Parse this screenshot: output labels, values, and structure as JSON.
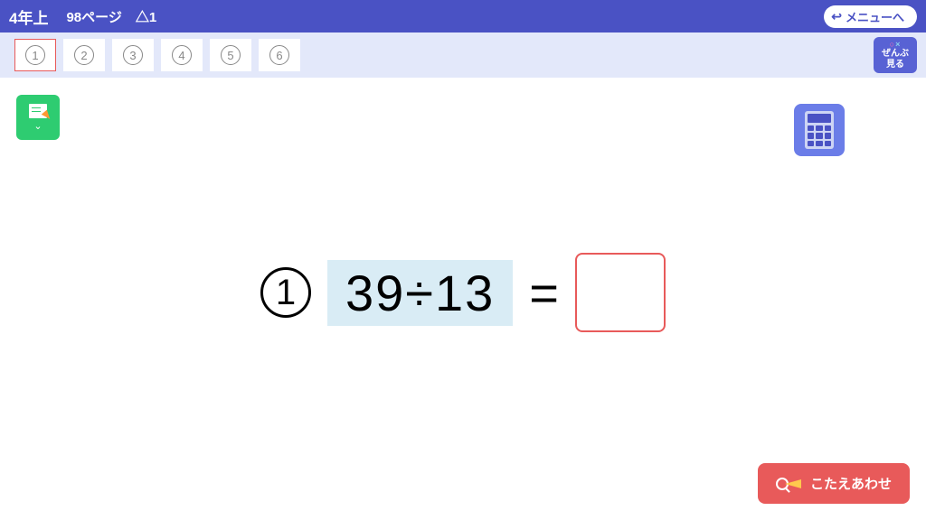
{
  "header": {
    "grade": "4年上",
    "page_info": "98ページ　△1",
    "menu_label": "メニューへ"
  },
  "nav": {
    "items": [
      "1",
      "2",
      "3",
      "4",
      "5",
      "6"
    ],
    "active_index": 0,
    "view_all_line1": "ぜんぶ",
    "view_all_line2": "見る"
  },
  "problem": {
    "number": "1",
    "expression": "39÷13",
    "equals": "="
  },
  "check_button": "こたえあわせ"
}
